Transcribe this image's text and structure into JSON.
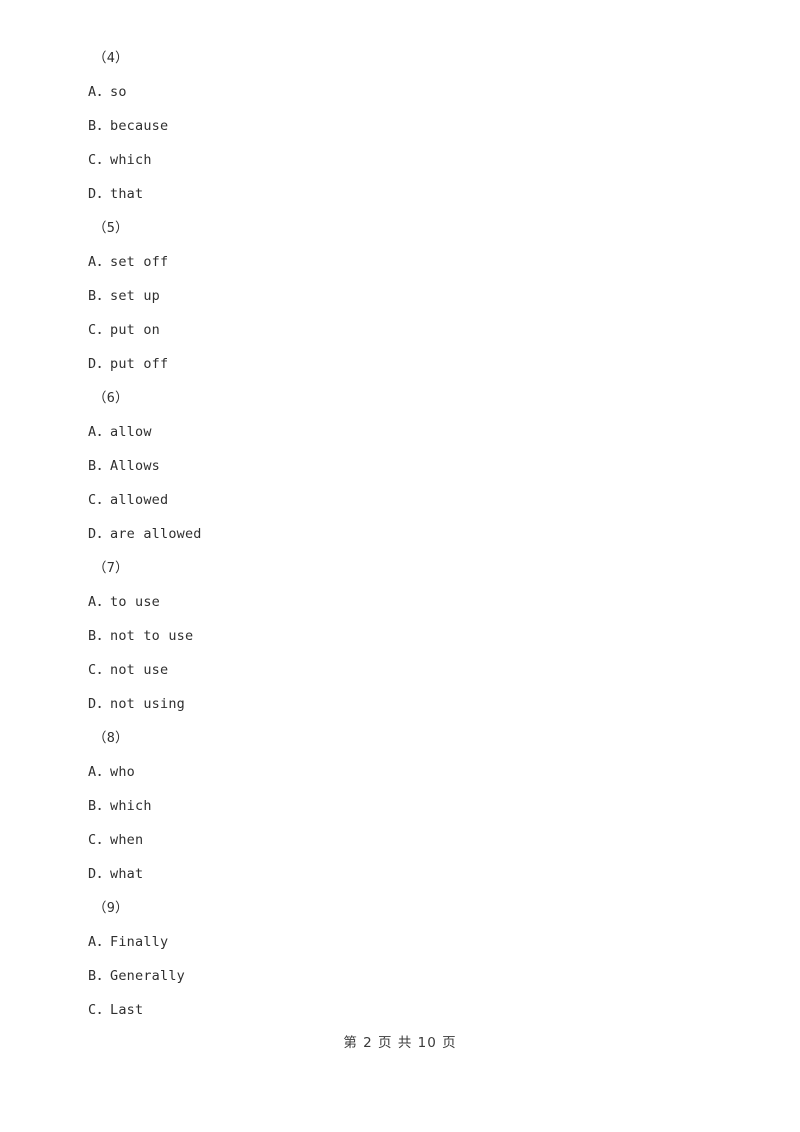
{
  "document": {
    "page_footer": "第 2 页 共 10 页",
    "text_color": "#2f2f2f",
    "background_color": "#ffffff"
  },
  "questions": [
    {
      "number": "（4）",
      "options": [
        "A．so",
        "B．because",
        "C．which",
        "D．that"
      ]
    },
    {
      "number": "（5）",
      "options": [
        "A．set off",
        "B．set up",
        "C．put on",
        "D．put off"
      ]
    },
    {
      "number": "（6）",
      "options": [
        "A．allow",
        "B．Allows",
        "C．allowed",
        "D．are allowed"
      ]
    },
    {
      "number": "（7）",
      "options": [
        "A．to use",
        "B．not to use",
        "C．not use",
        "D．not using"
      ]
    },
    {
      "number": "（8）",
      "options": [
        "A．who",
        "B．which",
        "C．when",
        "D．what"
      ]
    },
    {
      "number": "（9）",
      "options": [
        "A．Finally",
        "B．Generally",
        "C．Last"
      ]
    }
  ]
}
